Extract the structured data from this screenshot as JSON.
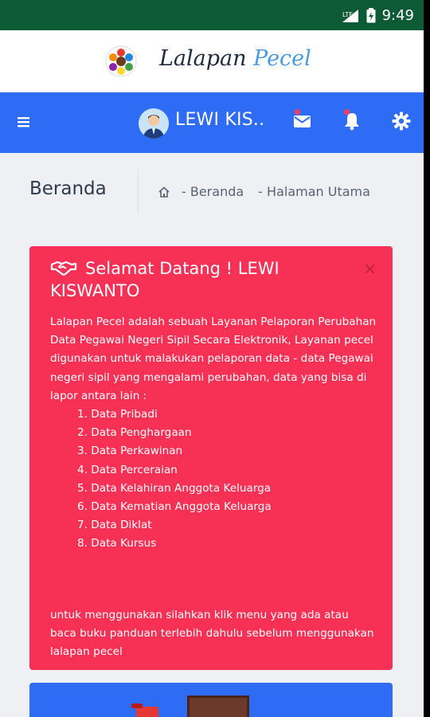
{
  "status_bar": {
    "time": "9:49"
  },
  "brand": {
    "name_part1": "Lalapan ",
    "name_part2": "Pecel"
  },
  "navbar": {
    "username": "LEWI KIS.."
  },
  "breadcrumb": {
    "page_title": "Beranda",
    "items": [
      "- Beranda",
      "- Halaman Utama"
    ]
  },
  "alert": {
    "title": "Selamat Datang ! LEWI KISWANTO",
    "close": "×",
    "intro": "Lalapan Pecel adalah sebuah Layanan Pelaporan Perubahan Data Pegawai Negeri Sipil Secara Elektronik, Layanan pecel digunakan untuk malakukan pelaporan data - data Pegawai negeri sipil yang mengalami perubahan, data yang bisa di lapor antara lain :",
    "list": [
      "1. Data Pribadi",
      "2. Data Penghargaan",
      "3. Data Perkawinan",
      "4. Data Perceraian",
      "5. Data Kelahiran Anggota Keluarga",
      "6. Data Kematian Anggota Keluarga",
      "7. Data Diklat",
      "8. Data Kursus"
    ],
    "footer": "untuk menggunakan silahkan klik menu yang ada atau baca buku panduan terlebih dahulu sebelum menggunakan lalapan pecel"
  },
  "colors": {
    "status_bar": "#0d5a36",
    "navbar": "#2f6cf6",
    "alert": "#f63155",
    "background": "#eef0f4"
  },
  "icons": [
    "signal-icon",
    "battery-icon",
    "logo-icon",
    "hamburger-icon",
    "user-avatar-icon",
    "mail-icon",
    "bell-icon",
    "gear-icon",
    "home-icon",
    "handshake-icon",
    "close-icon"
  ]
}
